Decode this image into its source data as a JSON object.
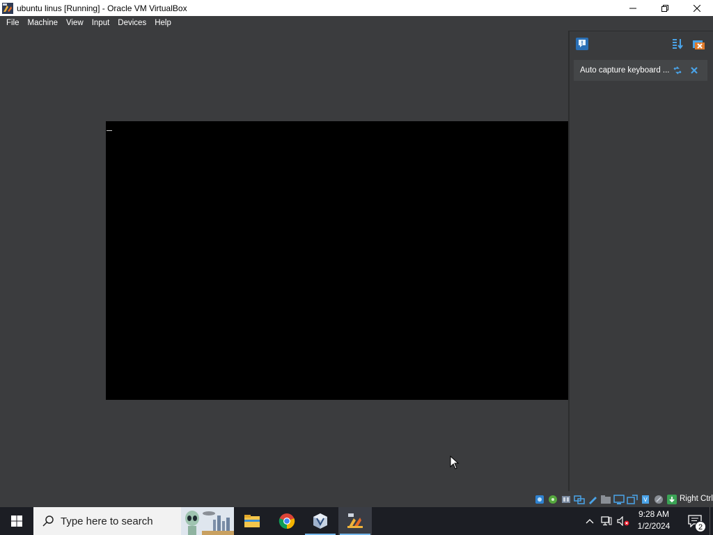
{
  "window": {
    "title": "ubuntu linus [Running] - Oracle VM VirtualBox",
    "minimize_icon": "minimize-icon",
    "maximize_icon": "restore-icon",
    "close_icon": "close-icon"
  },
  "menubar": {
    "items": [
      "File",
      "Machine",
      "View",
      "Input",
      "Devices",
      "Help"
    ]
  },
  "notification_panel": {
    "top_left_icon": "message-icon",
    "top_right_icons": [
      "sort-icon",
      "dismiss-all-icon"
    ],
    "items": [
      {
        "text": "Auto capture keyboard ...",
        "actions": [
          "toggle-icon",
          "close-icon"
        ]
      }
    ]
  },
  "statusbar": {
    "icons": [
      "hard-disk-icon",
      "optical-drive-icon",
      "audio-icon",
      "network-icon",
      "usb-icon",
      "shared-folders-icon",
      "display-icon",
      "recording-icon",
      "cpu-icon",
      "mouse-integration-icon",
      "keyboard-icon"
    ],
    "host_key": "Right Ctrl"
  },
  "taskbar": {
    "search_placeholder": "Type here to search",
    "apps": [
      "file-explorer-icon",
      "chrome-icon",
      "virtualbox-manager-icon",
      "virtualbox-vm-icon"
    ],
    "clock": {
      "time": "9:28 AM",
      "date": "1/2/2024"
    },
    "notification_count": "2",
    "colors": {
      "taskbar_bg": "#1c1e24",
      "accent": "#76b9ed"
    }
  }
}
